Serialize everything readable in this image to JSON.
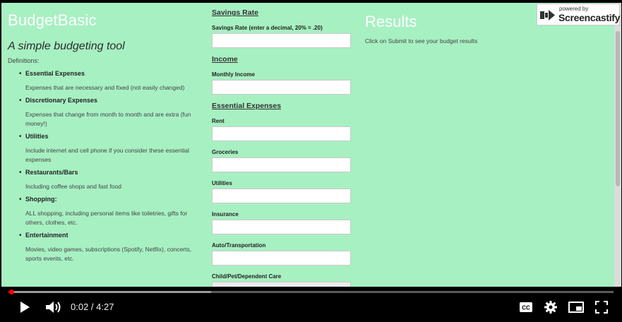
{
  "app": {
    "title": "BudgetBasic",
    "subtitle": "A simple budgeting tool",
    "definitions_label": "Definitions:"
  },
  "definitions": [
    {
      "term": "Essential Expenses",
      "desc": "Expenses that are necessary and fixed (not easily changed)"
    },
    {
      "term": "Discretionary Expenses",
      "desc": "Expenses that change from month to month and are extra (fun money!)"
    },
    {
      "term": "Utilities",
      "desc": "Include internet and cell phone if you consider these essential expenses"
    },
    {
      "term": "Restaurants/Bars",
      "desc": "Including coffee shops and fast food"
    },
    {
      "term": "Shopping:",
      "desc": "ALL shopping, including personal items like toiletries, gifts for others, clothes, etc."
    },
    {
      "term": "Entertainment",
      "desc": "Movies, video games, subscriptions (Spotify, Netflix), concerts, sports events, etc."
    }
  ],
  "form": {
    "savings_heading": "Savings Rate",
    "savings_label": "Savings Rate (enter a decimal, 20% = .20)",
    "income_heading": "Income",
    "income_label": "Monthly Income",
    "essential_heading": "Essential Expenses",
    "fields": [
      {
        "label": "Rent",
        "value": ""
      },
      {
        "label": "Groceries",
        "value": ""
      },
      {
        "label": "Utilities",
        "value": ""
      },
      {
        "label": "Insurance",
        "value": ""
      },
      {
        "label": "Auto/Transportation",
        "value": ""
      },
      {
        "label": "Child/Pet/Dependent Care",
        "value": ""
      }
    ]
  },
  "results": {
    "title": "Results",
    "message": "Click on Submit to see your budget results"
  },
  "watermark": {
    "small": "powered by",
    "brand": "Screencastify"
  },
  "player": {
    "time_text": "0:02 / 4:27",
    "played_fraction": 0.005,
    "buffered_fraction": 0.335,
    "cc_label": "CC",
    "icons": [
      "play-icon",
      "volume-icon",
      "cc-icon",
      "settings-icon",
      "miniplayer-icon",
      "fullscreen-icon"
    ],
    "accent_color": "#ff0000"
  },
  "colors": {
    "page_bg": "#a7f0c2"
  }
}
